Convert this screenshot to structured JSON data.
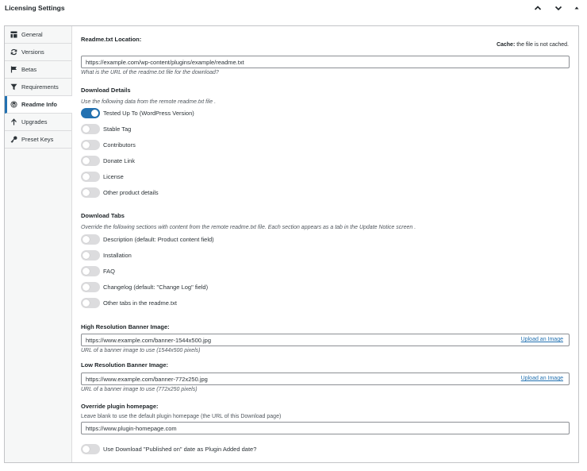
{
  "header": {
    "title": "Licensing Settings"
  },
  "sidebar": {
    "items": [
      {
        "label": "General",
        "icon": "table-icon"
      },
      {
        "label": "Versions",
        "icon": "sync-icon"
      },
      {
        "label": "Betas",
        "icon": "flag-icon"
      },
      {
        "label": "Requirements",
        "icon": "filter-icon"
      },
      {
        "label": "Readme Info",
        "icon": "wordpress-icon",
        "active": true
      },
      {
        "label": "Upgrades",
        "icon": "arrow-up-icon"
      },
      {
        "label": "Preset Keys",
        "icon": "key-icon"
      }
    ]
  },
  "readme": {
    "label": "Readme.txt Location:",
    "cache_label": "Cache:",
    "cache_text": "the file is not cached.",
    "url": "https://example.com/wp-content/plugins/example/readme.txt",
    "desc": "What is the URL of the readme.txt file for the download?"
  },
  "details": {
    "heading": "Download Details",
    "desc": "Use the following data from the remote readme.txt file .",
    "toggles": [
      {
        "label": "Tested Up To (WordPress Version)",
        "on": true
      },
      {
        "label": "Stable Tag",
        "on": false
      },
      {
        "label": "Contributors",
        "on": false
      },
      {
        "label": "Donate Link",
        "on": false
      },
      {
        "label": "License",
        "on": false
      },
      {
        "label": "Other product details",
        "on": false
      }
    ]
  },
  "tabs": {
    "heading": "Download Tabs",
    "desc": "Override the following sections with content from the remote readme.txt file. Each section appears as a tab in the Update Notice screen .",
    "toggles": [
      {
        "label": "Description (default: Product content field)",
        "on": false
      },
      {
        "label": "Installation",
        "on": false
      },
      {
        "label": "FAQ",
        "on": false
      },
      {
        "label": "Changelog (default: \"Change Log\" field)",
        "on": false
      },
      {
        "label": "Other tabs in the readme.txt",
        "on": false
      }
    ]
  },
  "banner_high": {
    "label": "High Resolution Banner Image:",
    "value": "https://www.example.com/banner-1544x500.jpg",
    "upload": "Upload an Image",
    "desc": "URL of a banner image to use (1544x500 pixels)"
  },
  "banner_low": {
    "label": "Low Resolution Banner Image:",
    "value": "https://www.example.com/banner-772x250.jpg",
    "upload": "Upload an Image",
    "desc": "URL of a banner image to use (772x250 pixels)"
  },
  "homepage": {
    "label": "Override plugin homepage:",
    "desc": "Leave blank to use the default plugin homepage (the URL of this Download page)",
    "value": "https://www.plugin-homepage.com"
  },
  "published": {
    "label": "Use Download \"Published on\" date as Plugin Added date?",
    "on": false
  },
  "colors": {
    "accent": "#2271b1",
    "toggle_off": "#dcdcde"
  }
}
